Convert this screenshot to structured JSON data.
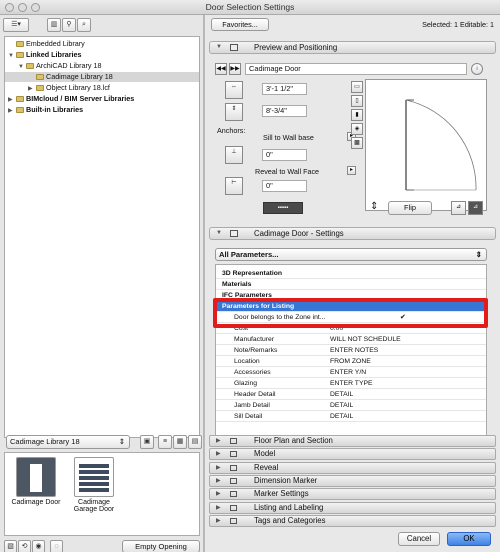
{
  "window": {
    "title": "Door Selection Settings"
  },
  "left": {
    "tree": [
      {
        "label": "Embedded Library",
        "level": 0,
        "arrow": "",
        "selected": false
      },
      {
        "label": "Linked Libraries",
        "level": 0,
        "arrow": "▼",
        "selected": false,
        "bold": true
      },
      {
        "label": "ArchiCAD Library 18",
        "level": 1,
        "arrow": "▼",
        "selected": false
      },
      {
        "label": "Cadimage Library 18",
        "level": 2,
        "arrow": "",
        "selected": true
      },
      {
        "label": "Object Library 18.lcf",
        "level": 2,
        "arrow": "▶",
        "selected": false
      },
      {
        "label": "BIMcloud / BIM Server Libraries",
        "level": 0,
        "arrow": "▶",
        "selected": false,
        "bold": true
      },
      {
        "label": "Built-in Libraries",
        "level": 0,
        "arrow": "▶",
        "selected": false,
        "bold": true
      }
    ],
    "library_select": "Cadimage Library 18",
    "thumbnails": [
      {
        "label": "Cadimage Door"
      },
      {
        "label": "Cadimage Garage Door"
      }
    ],
    "empty_opening": "Empty Opening"
  },
  "right": {
    "favorites": "Favorites...",
    "selected_info": "Selected: 1 Editable: 1",
    "preview_section": "Preview and Positioning",
    "object_name": "Cadimage Door",
    "width": "3'-1 1/2\"",
    "height": "8'-3/4\"",
    "anchors_label": "Anchors:",
    "sill_label": "Sill to Wall base",
    "sill_value": "0\"",
    "reveal_label": "Reveal to Wall Face",
    "reveal_value": "0\"",
    "flip": "Flip",
    "settings_section": "Cadimage Door - Settings",
    "all_params": "All Parameters...",
    "params": [
      {
        "name": "3D Representation",
        "value": "",
        "type": "group"
      },
      {
        "name": "Materials",
        "value": "",
        "type": "group"
      },
      {
        "name": "IFC Parameters",
        "value": "",
        "type": "group"
      },
      {
        "name": "Parameters for Listing",
        "value": "",
        "type": "highlight"
      },
      {
        "name": "Door belongs to the Zone int...",
        "value": "✔",
        "type": "row"
      },
      {
        "name": "Cost",
        "value": "0.00",
        "type": "row"
      },
      {
        "name": "Manufacturer",
        "value": "WILL NOT SCHEDULE",
        "type": "row"
      },
      {
        "name": "Note/Remarks",
        "value": "ENTER NOTES",
        "type": "row"
      },
      {
        "name": "Location",
        "value": "FROM ZONE",
        "type": "row"
      },
      {
        "name": "Accessories",
        "value": "ENTER Y/N",
        "type": "row"
      },
      {
        "name": "Glazing",
        "value": "ENTER TYPE",
        "type": "row"
      },
      {
        "name": "Header Detail",
        "value": "DETAIL",
        "type": "row"
      },
      {
        "name": "Jamb Detail",
        "value": "DETAIL",
        "type": "row"
      },
      {
        "name": "Sill Detail",
        "value": "DETAIL",
        "type": "row"
      }
    ],
    "categories": [
      "Floor Plan and Section",
      "Model",
      "Reveal",
      "Dimension Marker",
      "Marker Settings",
      "Listing and Labeling",
      "Tags and Categories"
    ],
    "cancel": "Cancel",
    "ok": "OK"
  }
}
